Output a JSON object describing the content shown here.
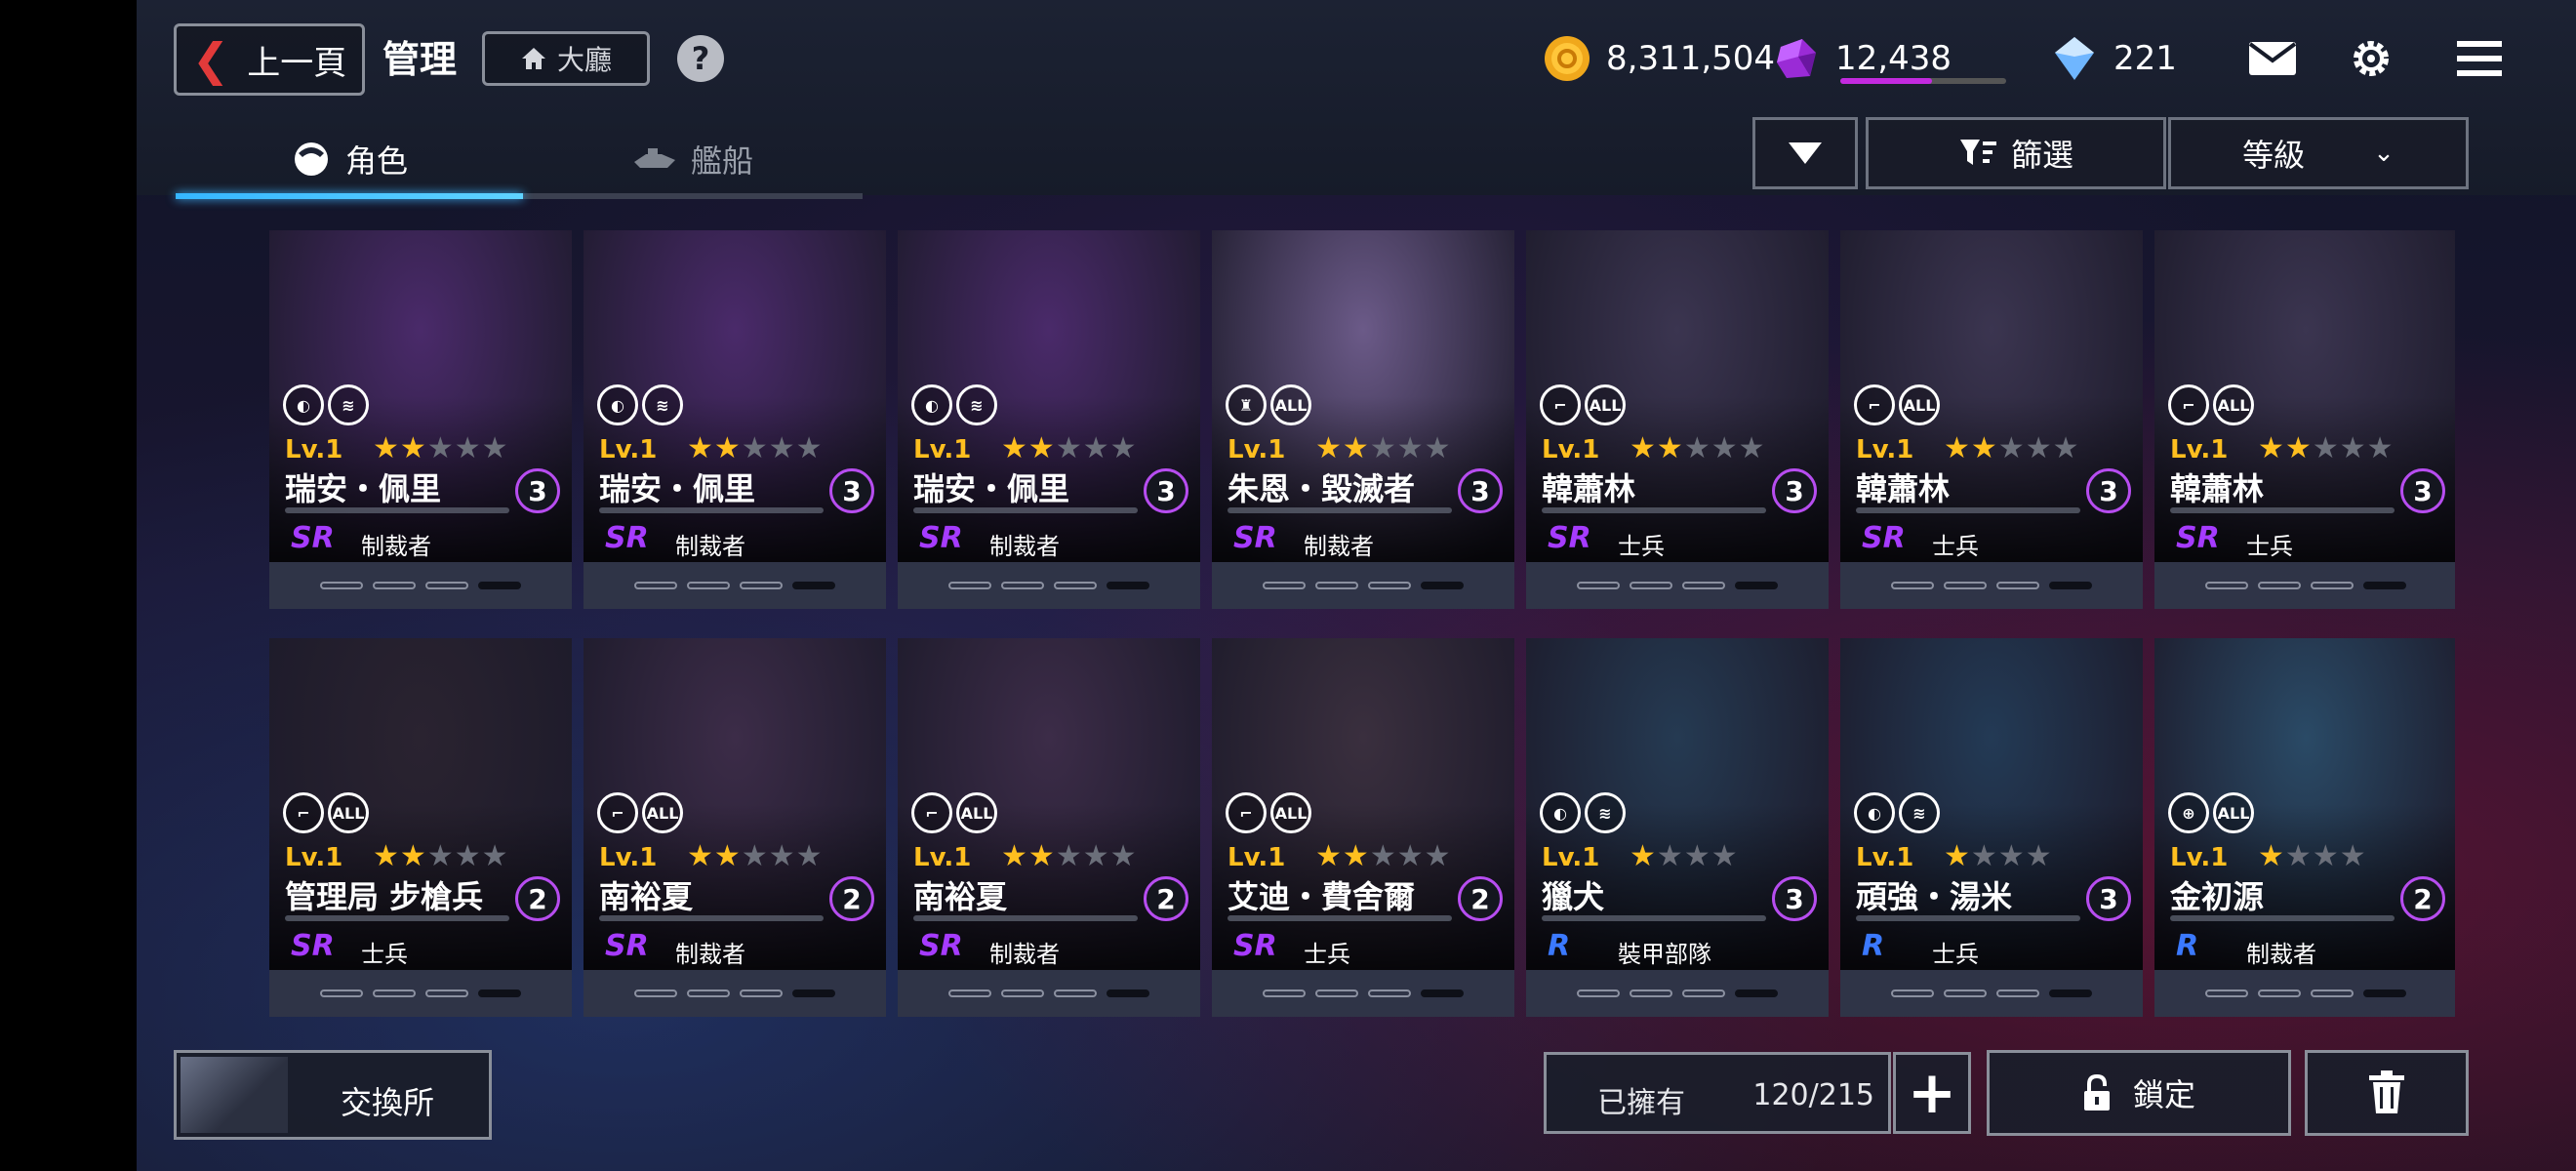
{
  "header": {
    "back_label": "上一頁",
    "title": "管理",
    "home_label": "大廳",
    "help_label": "?"
  },
  "resources": {
    "gold": "8,311,504",
    "gems": "12,438",
    "gems_bar_fraction": 0.55,
    "diamonds": "221"
  },
  "tabs": [
    {
      "label": "角色",
      "active": true
    },
    {
      "label": "艦船",
      "active": false
    }
  ],
  "controls": {
    "filter_label": "篩選",
    "sort_label": "等級"
  },
  "cards": [
    {
      "name": "瑞安・佩里",
      "level": "Lv.1",
      "stars": 2,
      "max_stars": 5,
      "badge": "3",
      "rarity": "SR",
      "class": "制裁者",
      "icons": [
        "shield-icon",
        "gauge-icon"
      ],
      "portrait": "#4a2a6a"
    },
    {
      "name": "瑞安・佩里",
      "level": "Lv.1",
      "stars": 2,
      "max_stars": 5,
      "badge": "3",
      "rarity": "SR",
      "class": "制裁者",
      "icons": [
        "shield-icon",
        "gauge-icon"
      ],
      "portrait": "#4a2a6a"
    },
    {
      "name": "瑞安・佩里",
      "level": "Lv.1",
      "stars": 2,
      "max_stars": 5,
      "badge": "3",
      "rarity": "SR",
      "class": "制裁者",
      "icons": [
        "shield-icon",
        "gauge-icon"
      ],
      "portrait": "#4a2a6a"
    },
    {
      "name": "朱恩・毀滅者",
      "level": "Lv.1",
      "stars": 2,
      "max_stars": 5,
      "badge": "3",
      "rarity": "SR",
      "class": "制裁者",
      "icons": [
        "rook-icon",
        "all-icon"
      ],
      "portrait": "#6b5a88"
    },
    {
      "name": "韓蕭林",
      "level": "Lv.1",
      "stars": 2,
      "max_stars": 5,
      "badge": "3",
      "rarity": "SR",
      "class": "士兵",
      "icons": [
        "rifle-icon",
        "all-icon"
      ],
      "portrait": "#3b3550"
    },
    {
      "name": "韓蕭林",
      "level": "Lv.1",
      "stars": 2,
      "max_stars": 5,
      "badge": "3",
      "rarity": "SR",
      "class": "士兵",
      "icons": [
        "rifle-icon",
        "all-icon"
      ],
      "portrait": "#3b3550"
    },
    {
      "name": "韓蕭林",
      "level": "Lv.1",
      "stars": 2,
      "max_stars": 5,
      "badge": "3",
      "rarity": "SR",
      "class": "士兵",
      "icons": [
        "rifle-icon",
        "all-icon"
      ],
      "portrait": "#3b3550"
    },
    {
      "name": "管理局 步槍兵",
      "level": "Lv.1",
      "stars": 2,
      "max_stars": 5,
      "badge": "2",
      "rarity": "SR",
      "class": "士兵",
      "icons": [
        "rifle-icon",
        "all-icon"
      ],
      "portrait": "#2a2330"
    },
    {
      "name": "南裕夏",
      "level": "Lv.1",
      "stars": 2,
      "max_stars": 5,
      "badge": "2",
      "rarity": "SR",
      "class": "制裁者",
      "icons": [
        "rifle-icon",
        "all-icon"
      ],
      "portrait": "#3c2c48"
    },
    {
      "name": "南裕夏",
      "level": "Lv.1",
      "stars": 2,
      "max_stars": 5,
      "badge": "2",
      "rarity": "SR",
      "class": "制裁者",
      "icons": [
        "rifle-icon",
        "all-icon"
      ],
      "portrait": "#3c2c48"
    },
    {
      "name": "艾迪・費舍爾",
      "level": "Lv.1",
      "stars": 2,
      "max_stars": 5,
      "badge": "2",
      "rarity": "SR",
      "class": "士兵",
      "icons": [
        "rifle-icon",
        "all-icon"
      ],
      "portrait": "#3a2f3e"
    },
    {
      "name": "獵犬",
      "level": "Lv.1",
      "stars": 1,
      "max_stars": 4,
      "badge": "3",
      "rarity": "R",
      "class": "裝甲部隊",
      "icons": [
        "shield-icon",
        "gauge-icon"
      ],
      "portrait": "#253a52"
    },
    {
      "name": "頑強・湯米",
      "level": "Lv.1",
      "stars": 1,
      "max_stars": 4,
      "badge": "3",
      "rarity": "R",
      "class": "士兵",
      "icons": [
        "shield-icon",
        "gauge-icon"
      ],
      "portrait": "#233a55"
    },
    {
      "name": "金初源",
      "level": "Lv.1",
      "stars": 1,
      "max_stars": 4,
      "badge": "2",
      "rarity": "R",
      "class": "制裁者",
      "icons": [
        "crosshair-icon",
        "all-icon"
      ],
      "portrait": "#2a4a66"
    }
  ],
  "bottom": {
    "exchange_label": "交換所",
    "owned_label": "已擁有",
    "owned_value": "120/215",
    "plus_label": "+",
    "lock_label": "鎖定"
  }
}
